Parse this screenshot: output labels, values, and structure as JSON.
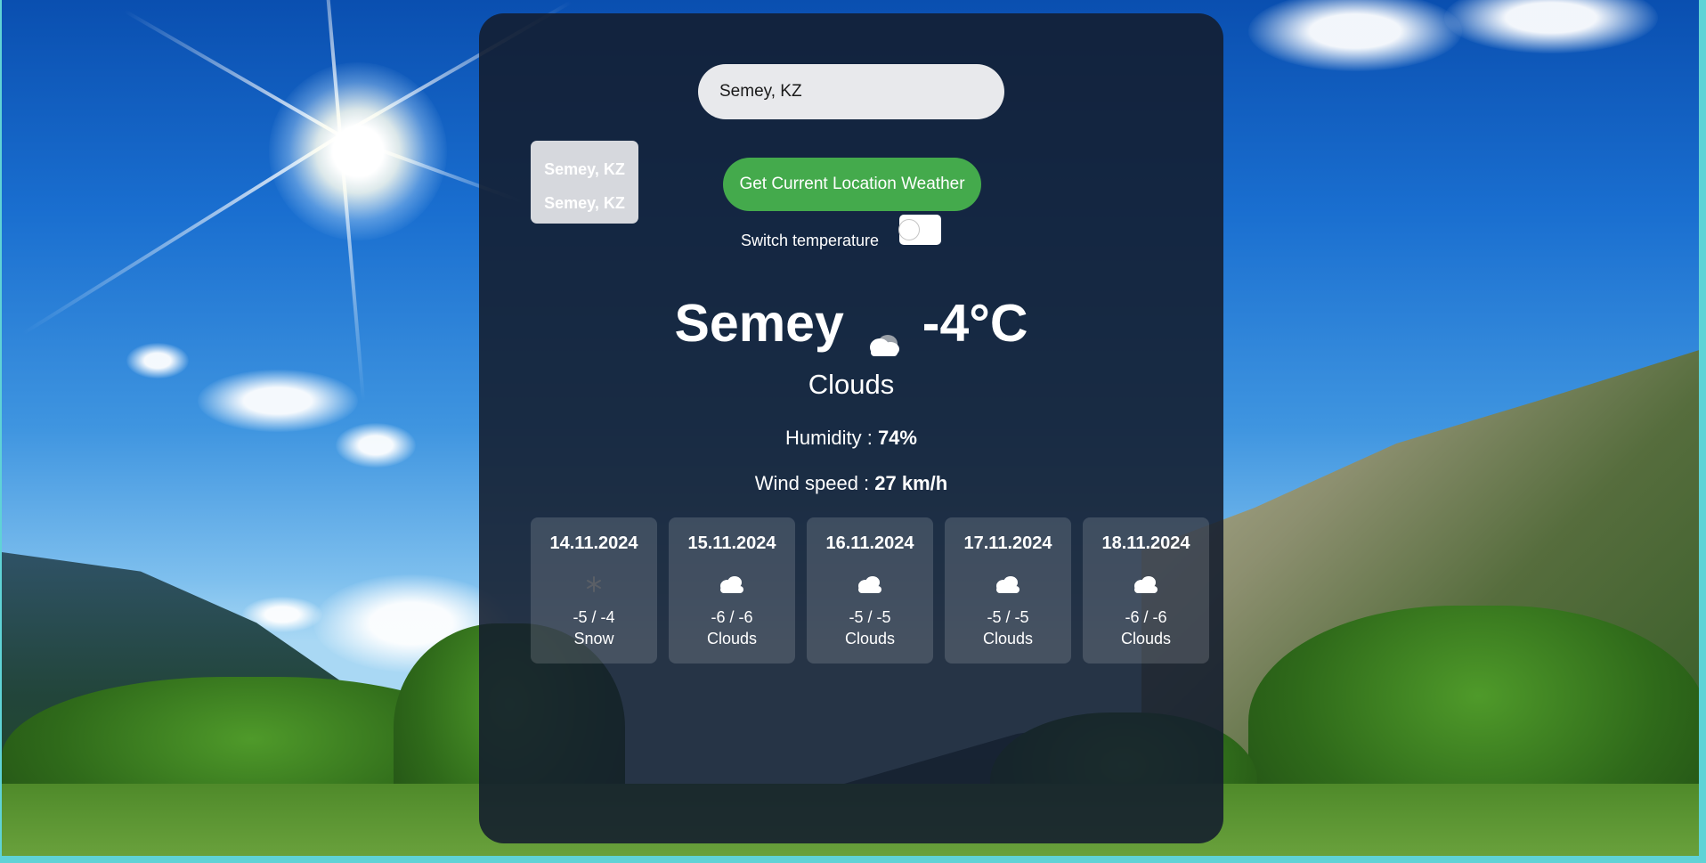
{
  "search": {
    "value": "Semey, KZ"
  },
  "suggestions": [
    "Semey, KZ",
    "Semey, KZ"
  ],
  "buttons": {
    "location_weather": "Get Current Location Weather"
  },
  "switch": {
    "label": "Switch temperature"
  },
  "current": {
    "city": "Semey",
    "icon": "cloud-icon",
    "temperature": "-4°C",
    "condition": "Clouds",
    "humidity_label": "Humidity :",
    "humidity_value": "74%",
    "wind_label": "Wind speed :",
    "wind_value": "27 km/h"
  },
  "forecast": [
    {
      "date": "14.11.2024",
      "icon": "snow-icon",
      "range": "-5 / -4",
      "condition": "Snow"
    },
    {
      "date": "15.11.2024",
      "icon": "cloud-icon",
      "range": "-6 / -6",
      "condition": "Clouds"
    },
    {
      "date": "16.11.2024",
      "icon": "cloud-icon",
      "range": "-5 / -5",
      "condition": "Clouds"
    },
    {
      "date": "17.11.2024",
      "icon": "cloud-icon",
      "range": "-5 / -5",
      "condition": "Clouds"
    },
    {
      "date": "18.11.2024",
      "icon": "cloud-icon",
      "range": "-6 / -6",
      "condition": "Clouds"
    }
  ],
  "colors": {
    "card": "#131c2e",
    "button": "#44aa4c",
    "search_bg": "#e8e9ec",
    "page_border": "#5fd3d6"
  }
}
